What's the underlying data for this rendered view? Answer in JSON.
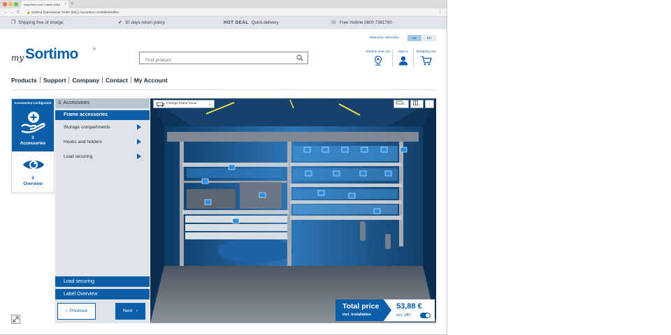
{
  "browser": {
    "tab_title": "mysortimo.com: Labels editor",
    "tab_close": "×",
    "new_tab": "+",
    "url_site": "Sortimo International GmbH [DE]",
    "url_separator": "|",
    "url_path": "mysortimo.com/labels/editor",
    "nav_back": "←",
    "nav_forward": "→",
    "nav_reload": "C",
    "menu": "⋮"
  },
  "infobar": {
    "shipping": "Shipping free of charge",
    "returns": "30 days return policy",
    "hot_deal": "HOT DEAL",
    "quick_delivery": "Quick delivery",
    "hotline": "Free Hotline 0800 7381780"
  },
  "logo": {
    "my": "my",
    "brand": "Sortimo",
    "reg": "®"
  },
  "search": {
    "placeholder": "Find product"
  },
  "header": {
    "welcome": "Welcome John Doe",
    "lang_de": "DE",
    "lang_en": "EN",
    "near_you": "Sortimo near you",
    "sign_in": "Sign in",
    "cart": "Shopping cart"
  },
  "nav": {
    "products": "Products",
    "support": "Support",
    "company": "Company",
    "contact": "Contact",
    "account": "My Account"
  },
  "steps": {
    "title": "Accessories Configurator",
    "accessories_num": "3",
    "accessories": "Accessories",
    "overview_num": "4",
    "overview": "Overview"
  },
  "accessories": {
    "heading": "3. Accessories",
    "selected": "Frame accessories",
    "items": [
      "Storage compartments",
      "Hooks and holders",
      "Load securing"
    ],
    "bottom_load_securing": "Load securing",
    "bottom_label_overview": "Label Overview",
    "prev": "Previous",
    "prev_arrow": "‹",
    "next": "Next",
    "next_arrow": "›"
  },
  "viewer": {
    "focus_label": "Change frame focus",
    "chevron": "⌄",
    "tool_dots": "⋮"
  },
  "price": {
    "title": "Total price",
    "subtitle": "incl. installation",
    "value": "53,88 €",
    "vat": "incl. VAT",
    "vat_toggle_on": true
  },
  "colors": {
    "brand_blue": "#0a5fa8",
    "panel_gray": "#dfe4ea",
    "viewer_bg": "#0e3f6a"
  }
}
